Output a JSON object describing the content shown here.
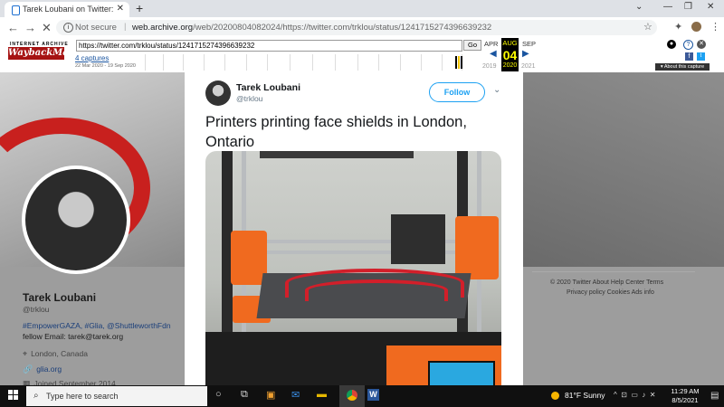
{
  "browser": {
    "tab_title": "Tarek Loubani on Twitter: \"Printe",
    "tab_close": "✕",
    "new_tab": "+",
    "security_label": "Not secure",
    "url_host": "web.archive.org",
    "url_path": "/web/20200804082024/https://twitter.com/trklou/status/1241715274396639232"
  },
  "wayback": {
    "logo_top": "INTERNET ARCHIVE",
    "logo_main": "WaybackMachine",
    "url_input": "https://twitter.com/trklou/status/1241715274396639232",
    "go_label": "Go",
    "captures_link": "4 captures",
    "capture_range": "22 Mar 2020 - 19 Sep 2020",
    "month_prev": "APR",
    "month_current": "AUG",
    "month_next": "SEP",
    "day_current": "04",
    "year_current": "2020",
    "year_prev": "2019",
    "year_next": "2021",
    "about_capture": "About this capture"
  },
  "profile": {
    "name": "Tarek Loubani",
    "handle": "@trklou",
    "bio_tags": "#EmpowerGAZA, #Glia, @ShuttleworthFdn",
    "bio_text": "fellow Email: tarek@tarek.org",
    "location": "London, Canada",
    "website": "glia.org",
    "joined": "Joined September 2014"
  },
  "footer": {
    "row1": "© 2020 Twitter   About   Help Center   Terms",
    "row2": "Privacy policy   Cookies   Ads info"
  },
  "tweet": {
    "author_name": "Tarek Loubani",
    "author_handle": "@trklou",
    "follow_label": "Follow",
    "text": "Printers printing face shields in London, Ontario"
  },
  "taskbar": {
    "search_placeholder": "Type here to search",
    "weather": "81°F  Sunny",
    "time": "11:29 AM",
    "date": "8/5/2021"
  },
  "colors": {
    "twitter_blue": "#1da1f2",
    "wayback_red": "#a61313",
    "printer_orange": "#f06a1f"
  }
}
